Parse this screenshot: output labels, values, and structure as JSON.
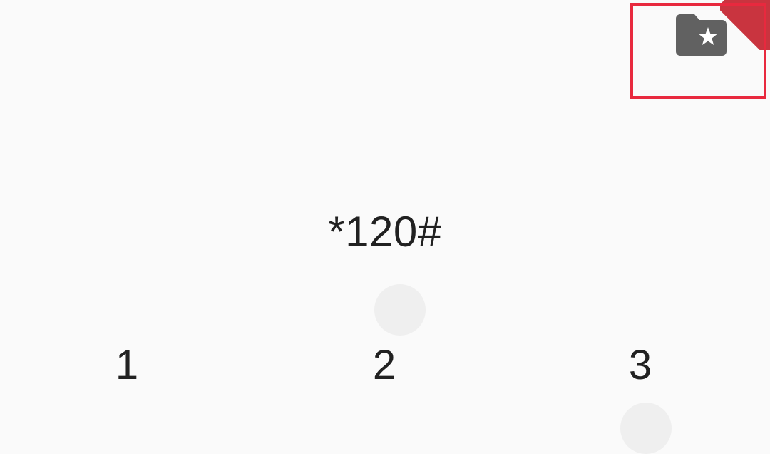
{
  "dialer": {
    "number": "*120#",
    "keys": [
      "1",
      "2",
      "3"
    ]
  },
  "favorites_button": {
    "icon": "folder-star-icon",
    "icon_color": "#616161",
    "highlight_color": "#e8293e"
  },
  "colors": {
    "background": "#fafafa",
    "text": "#212121",
    "ripple": "#efefef"
  }
}
